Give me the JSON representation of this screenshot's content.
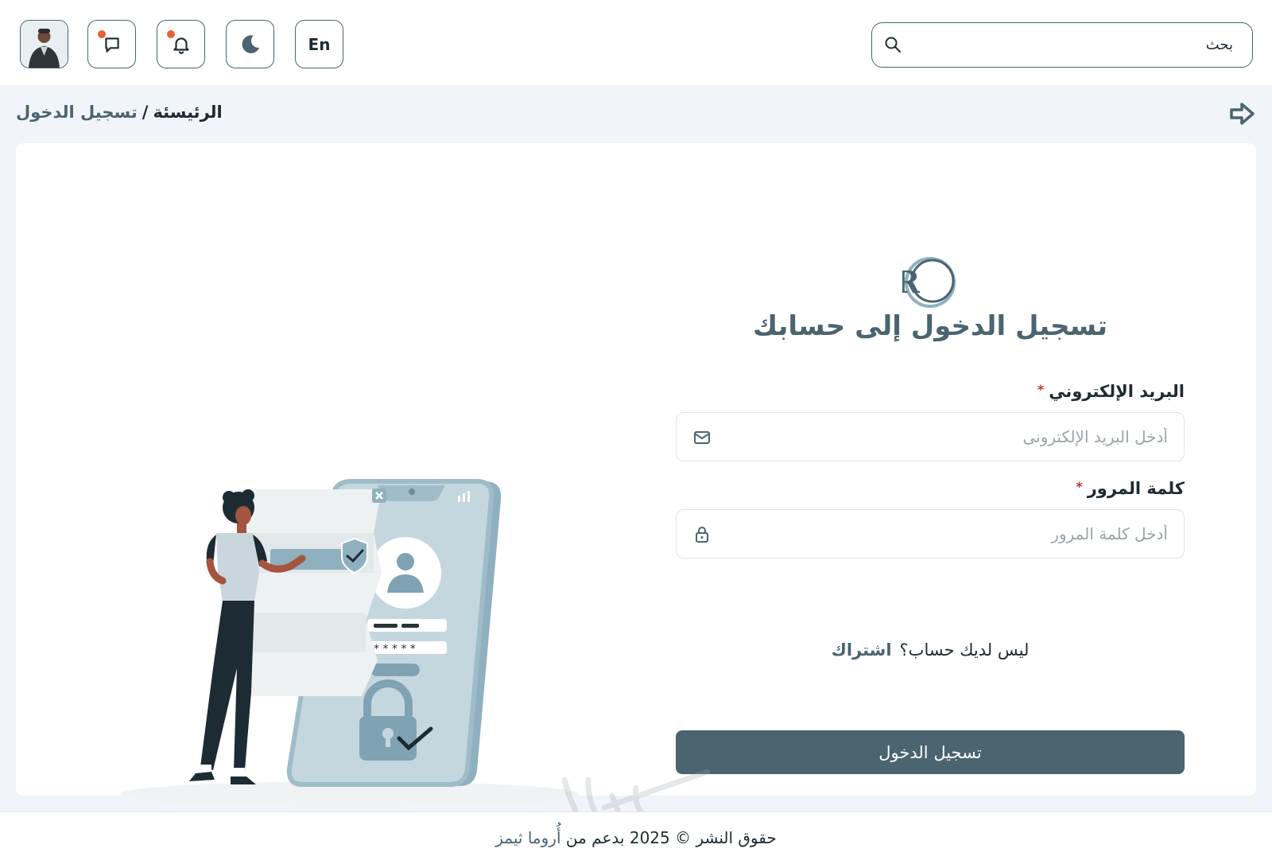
{
  "header": {
    "search_placeholder": "بحث",
    "lang_label": "En",
    "icons": {
      "search": "search-icon",
      "theme": "moon-icon",
      "notifications": "bell-icon",
      "messages": "chat-icon",
      "profile": "avatar"
    },
    "notification_dot_color": "#e8613a"
  },
  "breadcrumb": {
    "home": "الرئيسئة",
    "separator": "/",
    "current": "تسجيل الدخول"
  },
  "login": {
    "title": "تسجيل الدخول إلى حسابك",
    "email_label": "البريد الإلكتروني",
    "email_placeholder": "أدخل البريد الإلكترونى",
    "password_label": "كلمة المرور",
    "password_placeholder": "أدخل كلمة المرور",
    "required_mark": "*",
    "submit_label": "تسجيل الدخول",
    "no_account_text": "ليس لديك حساب؟",
    "signup_link": "اشتراك"
  },
  "footer": {
    "copyright": "حقوق النشر © 2025 بدعم من",
    "brand": "أُروما ثيمز"
  },
  "colors": {
    "primary": "#4a6470",
    "background": "#f1f4f8",
    "required": "#c0392b"
  }
}
